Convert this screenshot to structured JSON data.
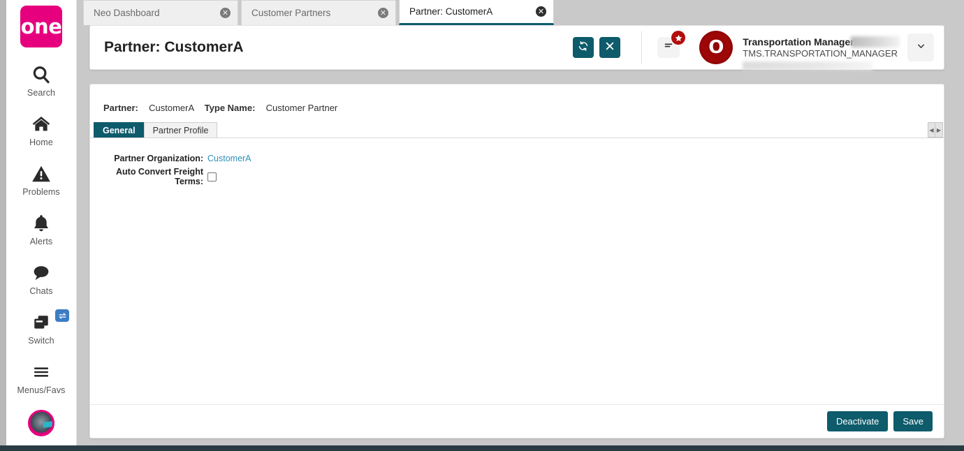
{
  "sidebar": {
    "logo_text": "one",
    "items": [
      {
        "label": "Search",
        "icon": "search-icon"
      },
      {
        "label": "Home",
        "icon": "home-icon"
      },
      {
        "label": "Problems",
        "icon": "warning-triangle-icon"
      },
      {
        "label": "Alerts",
        "icon": "bell-icon"
      },
      {
        "label": "Chats",
        "icon": "chat-bubble-icon"
      },
      {
        "label": "Switch",
        "icon": "switch-windows-icon",
        "badge_icon": "swap-arrows-icon"
      },
      {
        "label": "Menus/Favs",
        "icon": "hamburger-icon"
      }
    ],
    "avatar_icon": "bot-avatar-icon"
  },
  "tabs": [
    {
      "label": "Neo Dashboard",
      "active": false,
      "close_icon": "close-circle-icon"
    },
    {
      "label": "Customer Partners",
      "active": false,
      "close_icon": "close-circle-icon"
    },
    {
      "label": "Partner: CustomerA",
      "active": true,
      "close_icon": "close-circle-icon"
    }
  ],
  "header": {
    "title": "Partner: CustomerA",
    "refresh_icon": "refresh-icon",
    "close_icon": "close-x-icon",
    "menu_icon": "hamburger-menu-icon",
    "star_badge_icon": "star-icon",
    "user": {
      "logo_text": "O",
      "name": "Transportation Manager",
      "role": "TMS.TRANSPORTATION_MANAGER",
      "chevron_icon": "chevron-down-icon"
    }
  },
  "main": {
    "summary": {
      "partner_label": "Partner:",
      "partner_value": "CustomerA",
      "type_label": "Type Name:",
      "type_value": "Customer Partner"
    },
    "sub_tabs": [
      {
        "label": "General",
        "active": true
      },
      {
        "label": "Partner Profile",
        "active": false
      }
    ],
    "scroll_left_icon": "caret-left-icon",
    "scroll_right_icon": "caret-right-icon",
    "form": {
      "partner_org_label": "Partner Organization:",
      "partner_org_value": "CustomerA",
      "auto_convert_label": "Auto Convert Freight Terms:",
      "auto_convert_checked": false
    },
    "footer": {
      "deactivate_label": "Deactivate",
      "save_label": "Save"
    }
  },
  "colors": {
    "brand_pink": "#e6007e",
    "accent_teal": "#0d5b6b",
    "link_blue": "#2e8fb8",
    "badge_red": "#b30d0d",
    "badge_blue": "#3c7cc4"
  }
}
